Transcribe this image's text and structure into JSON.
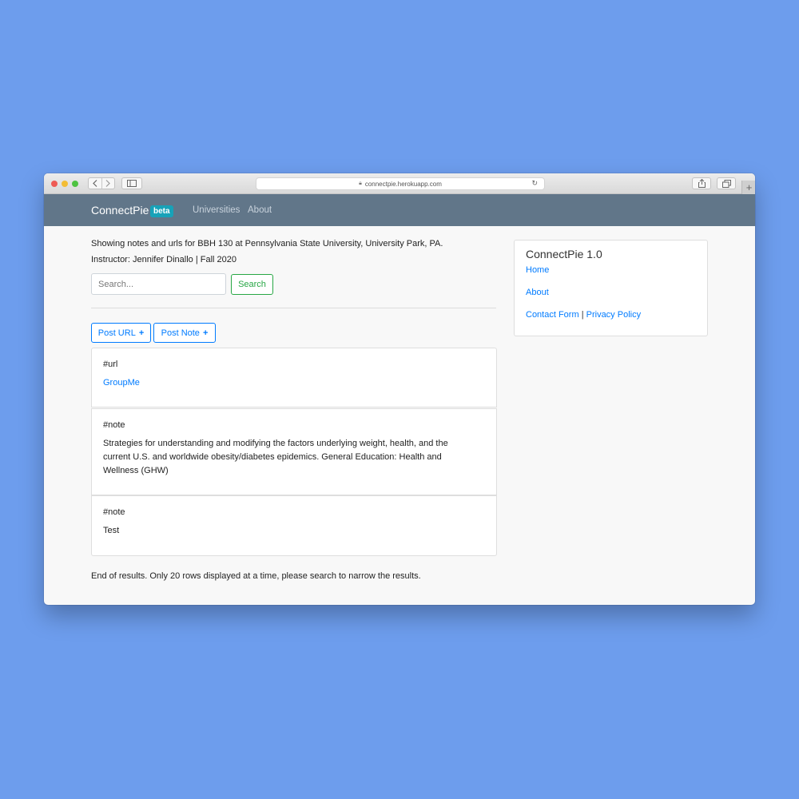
{
  "browser": {
    "url": "connectpie.herokuapp.com",
    "new_tab": "+"
  },
  "navbar": {
    "brand": "ConnectPie",
    "badge": "beta",
    "links": [
      "Universities",
      "About"
    ]
  },
  "main": {
    "info_line1": "Showing notes and urls for BBH 130 at Pennsylvania State University, University Park, PA.",
    "info_line2": "Instructor: Jennifer Dinallo | Fall 2020",
    "search": {
      "placeholder": "Search...",
      "button": "Search"
    },
    "post_url": "Post URL",
    "post_note": "Post Note",
    "plus": "+",
    "cards": [
      {
        "tag": "#url",
        "body": "GroupMe"
      },
      {
        "tag": "#note",
        "body": "Strategies for understanding and modifying the factors underlying weight, health, and the current U.S. and worldwide obesity/diabetes epidemics. General Education: Health and Wellness (GHW)"
      },
      {
        "tag": "#note",
        "body": "Test"
      }
    ],
    "footer": "End of results. Only 20 rows displayed at a time, please search to narrow the results."
  },
  "sidebar": {
    "title": "ConnectPie 1.0",
    "home": "Home",
    "about": "About",
    "contact": "Contact Form",
    "separator": "|",
    "privacy": "Privacy Policy"
  },
  "colors": {
    "background": "#6d9ded",
    "navbar": "#617689",
    "link": "#007bff",
    "success": "#28a745",
    "badge": "#17a2b8"
  }
}
